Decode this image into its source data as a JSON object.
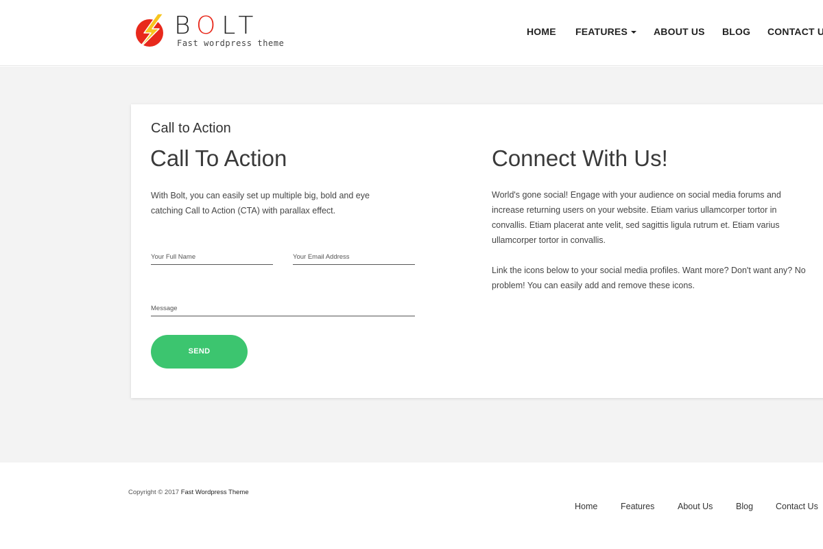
{
  "brand": {
    "logo_word_start": "B",
    "logo_word_accent": "O",
    "logo_word_end": "LT",
    "tagline": "Fast wordpress theme",
    "colors": {
      "accent_red": "#e8291c",
      "bolt_yellow": "#f7c51e",
      "button_green": "#3cc56f"
    }
  },
  "nav": {
    "items": [
      {
        "label": "HOME"
      },
      {
        "label": "FEATURES",
        "icon": "caret-down-icon"
      },
      {
        "label": "ABOUT US"
      },
      {
        "label": "BLOG"
      },
      {
        "label": "CONTACT U"
      }
    ]
  },
  "cta": {
    "small_title": "Call to Action",
    "heading": "Call To Action",
    "text": "With Bolt, you can easily set up multiple big, bold and eye catching Call to Action (CTA) with parallax effect.",
    "form": {
      "name_placeholder": "Your Full Name",
      "email_placeholder": "Your Email Address",
      "message_placeholder": "Message",
      "send_label": "SEND"
    }
  },
  "connect": {
    "heading": "Connect With Us!",
    "p1": "World's gone social! Engage with your audience on social media forums and increase returning users on your website. Etiam varius ullamcorper tortor in convallis. Etiam placerat ante velit, sed sagittis ligula rutrum et. Etiam varius ullamcorper tortor in convallis.",
    "p2": "Link the icons below to your social media profiles. Want more? Don't want any? No problem! You can easily add and remove these icons."
  },
  "footer": {
    "copyright_prefix": "Copyright © 2017 ",
    "copyright_brand": "Fast Wordpress Theme",
    "links": [
      {
        "label": "Home"
      },
      {
        "label": "Features"
      },
      {
        "label": "About Us"
      },
      {
        "label": "Blog"
      },
      {
        "label": "Contact Us"
      }
    ]
  }
}
